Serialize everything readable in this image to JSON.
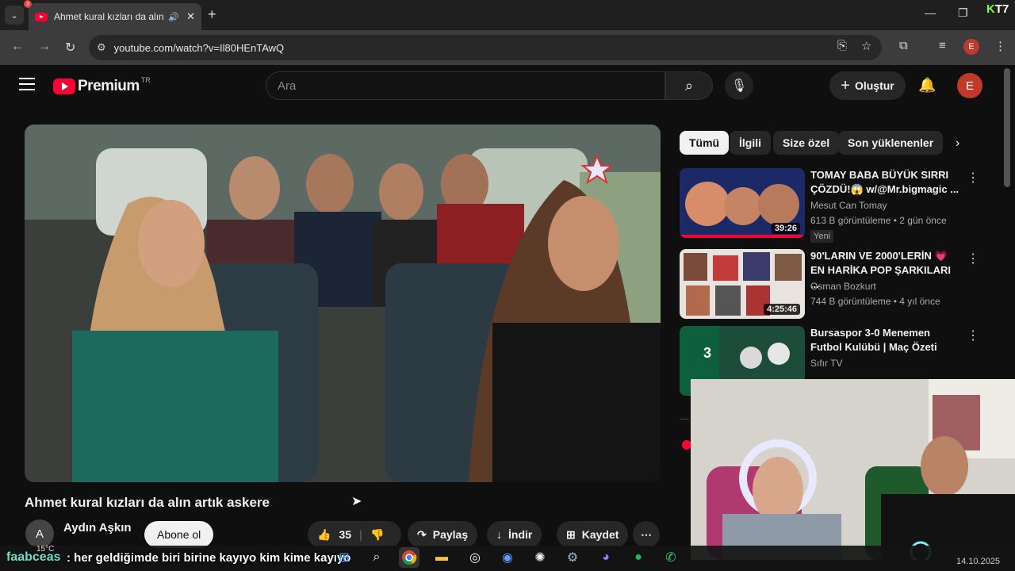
{
  "browser": {
    "tab_title": "Ahmet kural kızları da alın a",
    "url": "youtube.com/watch?v=Il80HEnTAwQ",
    "profile_initial": "E",
    "corner_logo": {
      "k": "K",
      "num": "T7"
    }
  },
  "youtube": {
    "logo_text": "Premium",
    "region": "TR",
    "search_placeholder": "Ara",
    "create_label": "Oluştur",
    "avatar_initial": "E"
  },
  "video": {
    "title": "Ahmet kural kızları da alın artık askere",
    "channel_initial": "A",
    "channel_name": "Aydın Aşkın",
    "subscribe_label": "Abone ol",
    "likes": "35",
    "share_label": "Paylaş",
    "download_label": "İndir",
    "save_label": "Kaydet"
  },
  "chips": [
    "Tümü",
    "İlgili",
    "Size özel",
    "Son yüklenenler"
  ],
  "recommendations": [
    {
      "title": "TOMAY BABA BÜYÜK SIRRI ÇÖZDÜ!😱 w/@Mr.bigmagic ...",
      "channel": "Mesut Can Tomay",
      "meta": "613 B görüntüleme • 2 gün önce",
      "badge": "Yeni",
      "duration": "39:26"
    },
    {
      "title": "90'LARIN VE 2000'LERİN 💗 EN HARİKA POP ŞARKILARI ...",
      "channel": "Osman Bozkurt",
      "meta": "744 B görüntüleme • 4 yıl önce",
      "badge": "",
      "duration": "4:25:46"
    },
    {
      "title": "Bursaspor 3-0 Menemen Futbol Kulübü | Maç Özeti",
      "channel": "Sıfır TV",
      "meta": "",
      "badge": "",
      "duration": ""
    }
  ],
  "taskbar": {
    "weather_badge": "3",
    "temperature": "15°C",
    "date": "14.10.2025"
  },
  "stream_overlay": {
    "username": "faabceas",
    "message": ": her geldiğimde biri birine kayıyo kim kime kayıyo"
  },
  "colors": {
    "accent_red": "#ff0033",
    "background": "#0f0f0f"
  }
}
